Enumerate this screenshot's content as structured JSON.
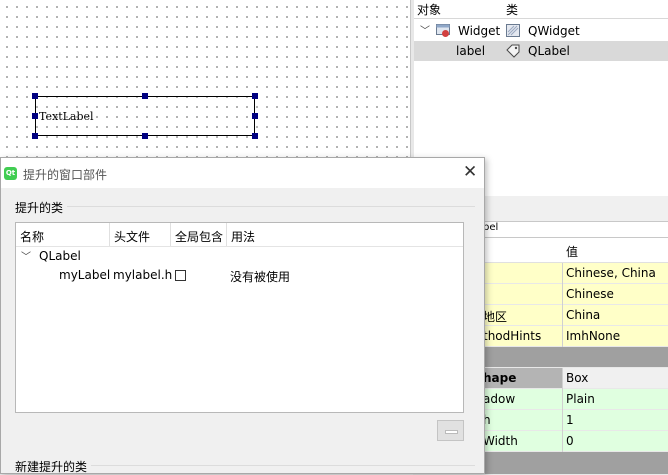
{
  "canvas": {
    "textlabel_text": "TextLabel"
  },
  "object_inspector": {
    "headers": {
      "object": "对象",
      "class": "类"
    },
    "rows": [
      {
        "name": "Widget",
        "class": "QWidget",
        "expanded": true
      },
      {
        "name": "label",
        "class": "QLabel",
        "selected": true
      }
    ]
  },
  "property_editor": {
    "filter_fragment": "bel",
    "value_header": "值",
    "rows": [
      {
        "name": "",
        "value": "Chinese, China",
        "style": "yellow"
      },
      {
        "name": "",
        "value": "Chinese",
        "style": "yellow"
      },
      {
        "name": "地区",
        "value": "China",
        "style": "yellow"
      },
      {
        "name": "thodHints",
        "value": "ImhNone",
        "style": "yellow"
      },
      {
        "name": "",
        "value": "",
        "style": "gray"
      },
      {
        "name": "hape",
        "value": "Box",
        "style": "gray2"
      },
      {
        "name": "adow",
        "value": "Plain",
        "style": "green"
      },
      {
        "name": "h",
        "value": "1",
        "style": "green"
      },
      {
        "name": "Width",
        "value": "0",
        "style": "green"
      },
      {
        "name": "",
        "value": "",
        "style": "gray"
      }
    ]
  },
  "dialog": {
    "title": "提升的窗口部件",
    "qt_icon_text": "Qt",
    "close_glyph": "✕",
    "group_promoted": "提升的类",
    "tree_headers": [
      "名称",
      "头文件",
      "全局包含",
      "用法"
    ],
    "base_class": "QLabel",
    "promoted_items": [
      {
        "name": "myLabel",
        "header": "mylabel.h",
        "global_include": false,
        "usage": "没有被使用"
      }
    ],
    "group_new": "新建提升的类"
  },
  "colors": {
    "selection_handle": "#000080",
    "prop_yellow": "#ffffc8",
    "prop_green": "#e0ffe0",
    "qt_green": "#41cd52"
  }
}
